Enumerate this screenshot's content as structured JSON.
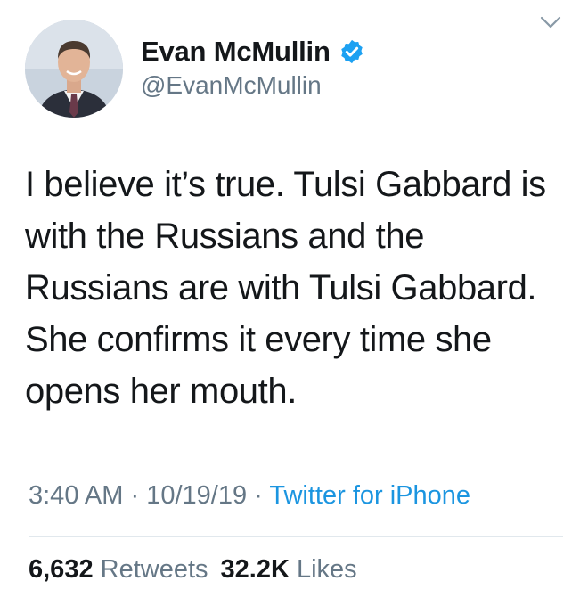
{
  "user": {
    "display_name": "Evan McMullin",
    "handle": "@EvanMcMullin",
    "verified": true,
    "avatar_icon": "profile-photo"
  },
  "tweet": {
    "text": "I believe it’s true. Tulsi Gabbard is with the Russians and the Russians are with Tulsi Gabbard. She confirms it every time she opens her mouth."
  },
  "meta": {
    "time": "3:40 AM",
    "separator": "·",
    "date": "10/19/19",
    "source": "Twitter for iPhone"
  },
  "stats": {
    "retweets_count": "6,632",
    "retweets_label": "Retweets",
    "likes_count": "32.2K",
    "likes_label": "Likes"
  },
  "colors": {
    "text": "#14171a",
    "secondary": "#657786",
    "link": "#1b95e0",
    "verified": "#1da1f2",
    "divider": "#e1e8ed"
  }
}
